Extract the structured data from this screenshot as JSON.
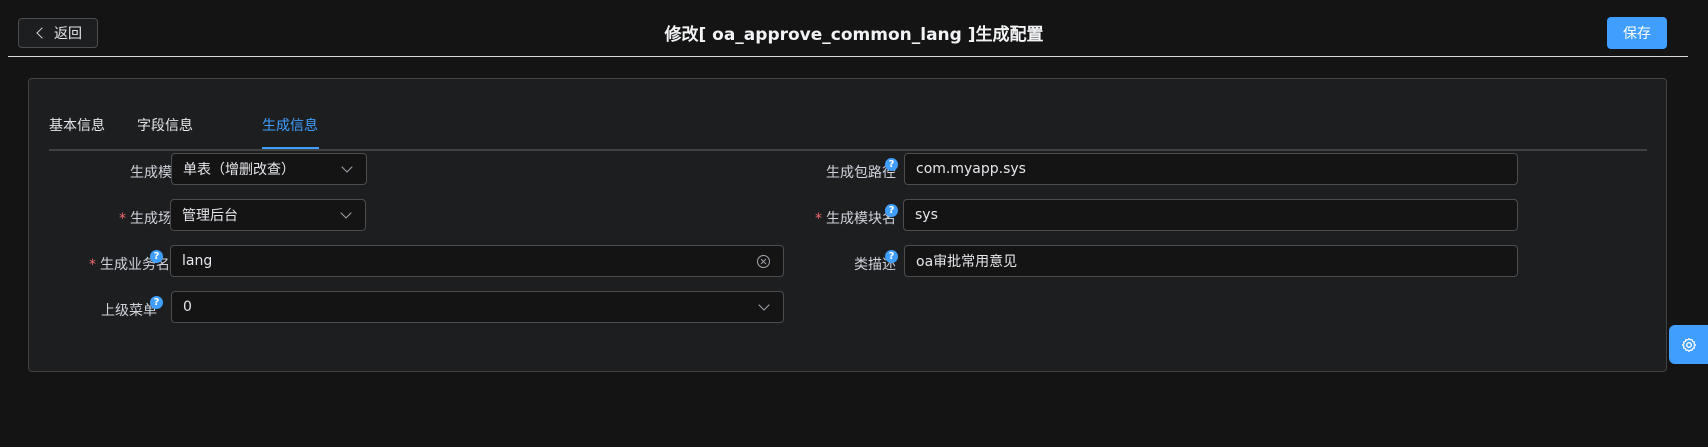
{
  "header": {
    "back_label": "返回",
    "title": "修改[ oa_approve_common_lang ]生成配置",
    "save_label": "保存"
  },
  "tabs": [
    {
      "label": "基本信息",
      "active": false
    },
    {
      "label": "字段信息",
      "active": false
    },
    {
      "label": "生成信息",
      "active": true
    }
  ],
  "form": {
    "template": {
      "label": "生成模板",
      "value": "单表（增删改查）",
      "required": false
    },
    "scene": {
      "label": "生成场景",
      "value": "管理后台",
      "required": true
    },
    "business_name": {
      "label": "生成业务名",
      "value": "lang",
      "required": true
    },
    "parent_menu": {
      "label": "上级菜单",
      "value": "0",
      "required": false
    },
    "package_path": {
      "label": "生成包路径",
      "value": "com.myapp.sys",
      "required": false
    },
    "module_name": {
      "label": "生成模块名",
      "value": "sys",
      "required": true
    },
    "class_desc": {
      "label": "类描述",
      "value": "oa审批常用意见",
      "required": false
    }
  },
  "symbols": {
    "required_mark": "*",
    "help_mark": "?"
  },
  "colors": {
    "accent": "#409eff",
    "required": "#f56c6c",
    "background": "#141414"
  },
  "icons": {
    "back": "chevron-left-icon",
    "help": "question-circle-icon",
    "clear": "circle-close-icon",
    "settings": "gear-icon",
    "dropdown": "chevron-down-icon"
  }
}
